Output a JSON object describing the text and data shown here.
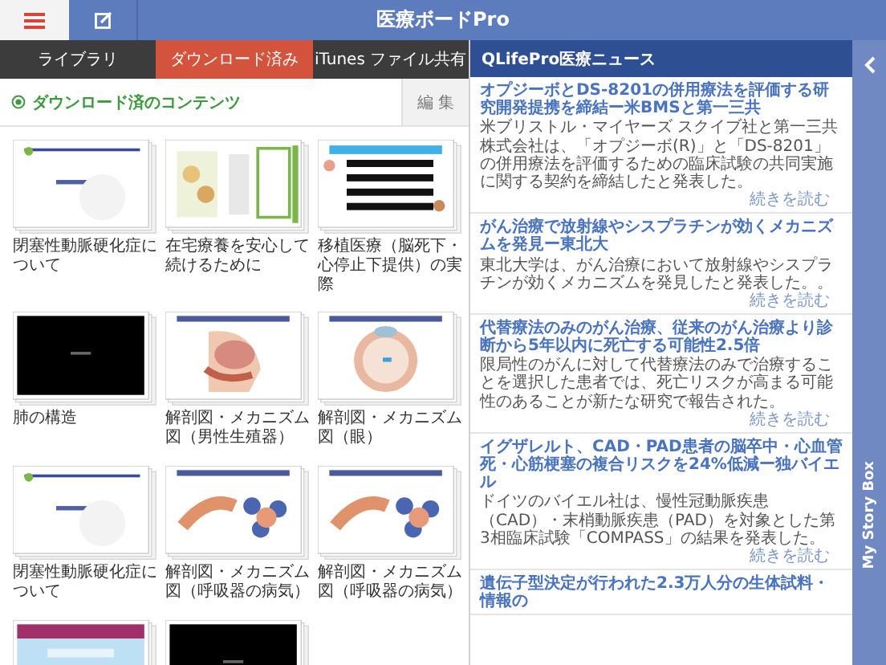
{
  "app_title": "医療ボードPro",
  "tabs": [
    {
      "label": "ライブラリ",
      "selected": false
    },
    {
      "label": "ダウンロード済み",
      "selected": true
    },
    {
      "label": "iTunes ファイル共有",
      "selected": false
    }
  ],
  "section": {
    "title": "ダウンロード済のコンテンツ",
    "edit_button": "編 集"
  },
  "contents": [
    {
      "kind": "picture",
      "label": "閉塞性動脈硬化症について"
    },
    {
      "kind": "picture",
      "label": "在宅療養を安心して続けるために"
    },
    {
      "kind": "picture",
      "label": "移植医療（脳死下・心停止下提供）の実際"
    },
    {
      "kind": "picture",
      "label": "肺の構造"
    },
    {
      "kind": "picture",
      "label": "解剖図・メカニズム図（男性生殖器）"
    },
    {
      "kind": "picture",
      "label": "解剖図・メカニズム図（眼）"
    },
    {
      "kind": "picture",
      "label": "閉塞性動脈硬化症について"
    },
    {
      "kind": "picture",
      "label": "解剖図・メカニズム図（呼吸器の病気）"
    },
    {
      "kind": "picture",
      "label": "解剖図・メカニズム図（呼吸器の病気）"
    },
    {
      "kind": "picture"
    },
    {
      "kind": "picture"
    }
  ],
  "news": {
    "title": "QLifePro医療ニュース",
    "items": [
      {
        "headline": "オプジーボとDS-8201の併用療法を評価する研究開発提携を締結ー米BMSと第一三共",
        "summary": "米ブリストル・マイヤーズ スクイブ社と第一三共株式会社は、「オプジーボ(R)」と「DS-8201」の併用療法を評価するための臨床試験の共同実施に関する契約を締結したと発表した。",
        "more": "続きを読む"
      },
      {
        "headline": "がん治療で放射線やシスプラチンが効くメカニズムを発見ー東北大",
        "summary": "東北大学は、がん治療において放射線やシスプラチンが効くメカニズムを発見したと発表した。。",
        "more": "続きを読む"
      },
      {
        "headline": "代替療法のみのがん治療、従来のがん治療より診断から5年以内に死亡する可能性2.5倍",
        "summary": "限局性のがんに対して代替療法のみで治療することを選択した患者では、死亡リスクが高まる可能性のあることが新たな研究で報告された。",
        "more": "続きを読む"
      },
      {
        "headline": "イグザレルト、CAD・PAD患者の脳卒中・心血管死・心筋梗塞の複合リスクを24%低減ー独バイエル",
        "summary": "ドイツのバイエル社は、慢性冠動脈疾患（CAD）・末梢動脈疾患（PAD）を対象とした第3相臨床試験「COMPASS」の結果を発表した。",
        "more": "続きを読む"
      },
      {
        "headline": "遺伝子型決定が行われた2.3万人分の生体試料・情報の"
      }
    ]
  },
  "side_tab": {
    "label": "My Story Box"
  }
}
